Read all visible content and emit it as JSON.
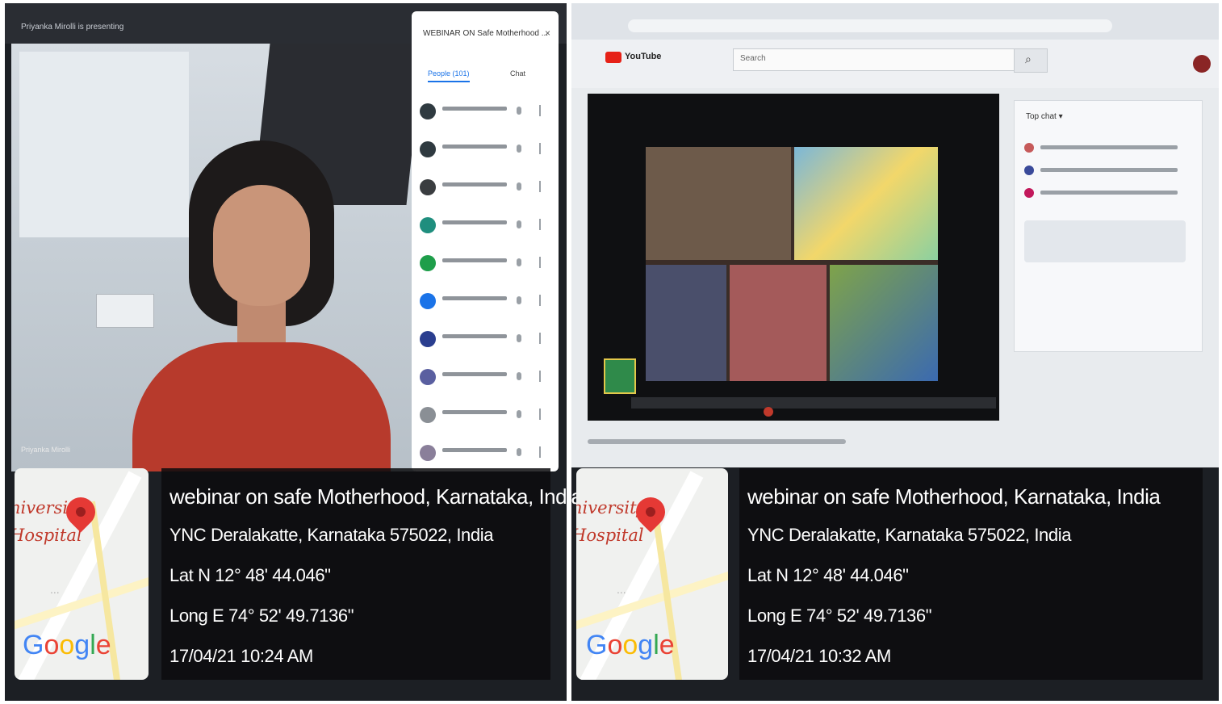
{
  "panels": [
    {
      "title": "webinar on safe Motherhood, Karnataka, India",
      "address": "YNC Deralakatte, Karnataka 575022, India",
      "lat": "Lat N 12° 48' 44.046\"",
      "long": "Long E 74° 52' 49.7136\"",
      "datetime": "17/04/21 10:24 AM",
      "map_label_line1": "niversity",
      "map_label_line2": "Hospital",
      "map_dots": "...",
      "map_brand": [
        "G",
        "o",
        "o",
        "g",
        "l",
        "e"
      ]
    },
    {
      "title": "webinar on safe Motherhood, Karnataka, India",
      "address": "YNC Deralakatte, Karnataka 575022, India",
      "lat": "Lat N 12° 48' 44.046\"",
      "long": "Long E 74° 52' 49.7136\"",
      "datetime": "17/04/21 10:32 AM",
      "map_label_line1": "niversity",
      "map_label_line2": "Hospital",
      "map_dots": "...",
      "map_brand": [
        "G",
        "o",
        "o",
        "g",
        "l",
        "e"
      ]
    }
  ],
  "meet": {
    "presenting_text": "Priyanka Mirolli is presenting",
    "panel_title": "WEBINAR ON Safe Motherhood ...",
    "close_glyph": "×",
    "tab_people": "People (101)",
    "tab_chat": "Chat",
    "participant_name": "Priyanka Mirolli",
    "participant_colors": [
      "#2f3a40",
      "#2f3a40",
      "#3a3d40",
      "#1f8e7e",
      "#1e9e4a",
      "#1a73e8",
      "#2a3e8f",
      "#5a5fa0",
      "#8a8f95",
      "#8a7f9a"
    ]
  },
  "youtube": {
    "search_placeholder": "Search",
    "logo_text": "YouTube",
    "chat_title": "Top chat ▾",
    "chat_avatar_colors": [
      "#c65a5a",
      "#3a4a9a",
      "#c2185b"
    ]
  },
  "colors": {
    "overlay_bg": "#0c0c0e",
    "pin": "#e53935",
    "map_label": "#c0392b"
  }
}
